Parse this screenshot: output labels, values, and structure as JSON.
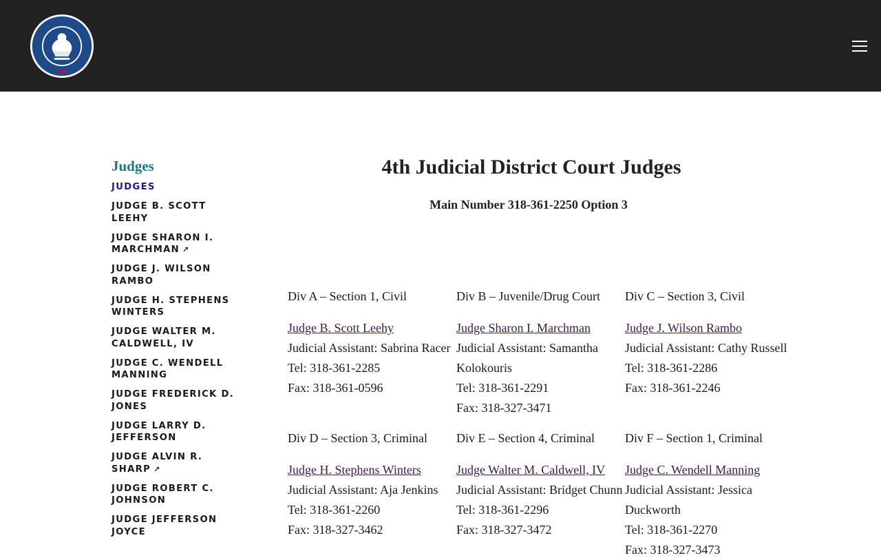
{
  "header": {
    "seal_text": "STATE OF LOUISIANA",
    "seal_motto": "UNION · JUSTICE · CONFIDENCE",
    "menu_icon": "hamburger-menu-icon"
  },
  "sidebar": {
    "heading": "Judges",
    "items": [
      {
        "label": "JUDGES",
        "active": true,
        "external": false
      },
      {
        "label": "JUDGE B. SCOTT LEEHY",
        "active": false,
        "external": false
      },
      {
        "label": "JUDGE SHARON I. MARCHMAN",
        "active": false,
        "external": true
      },
      {
        "label": "JUDGE J. WILSON RAMBO",
        "active": false,
        "external": false
      },
      {
        "label": "JUDGE H. STEPHENS WINTERS",
        "active": false,
        "external": false
      },
      {
        "label": "JUDGE WALTER M. CALDWELL, IV",
        "active": false,
        "external": false
      },
      {
        "label": "JUDGE C. WENDELL MANNING",
        "active": false,
        "external": false
      },
      {
        "label": "JUDGE FREDERICK D. JONES",
        "active": false,
        "external": false
      },
      {
        "label": "JUDGE LARRY D. JEFFERSON",
        "active": false,
        "external": false
      },
      {
        "label": "JUDGE ALVIN R. SHARP",
        "active": false,
        "external": true
      },
      {
        "label": "JUDGE ROBERT C. JOHNSON",
        "active": false,
        "external": false
      },
      {
        "label": "JUDGE JEFFERSON JOYCE",
        "active": false,
        "external": false
      }
    ],
    "external_glyph": "↗"
  },
  "main": {
    "title": "4th Judicial District Court Judges",
    "main_number": "Main Number 318-361-2250 Option 3",
    "divisions": [
      {
        "division": "Div A – Section 1, Civil",
        "judge": "Judge B. Scott Leehy",
        "assistant": "Judicial Assistant: Sabrina Racer",
        "tel": "Tel: 318-361-2285",
        "fax": "Fax: 318-361-0596"
      },
      {
        "division": "Div B – Juvenile/Drug Court",
        "judge": "Judge Sharon I. Marchman",
        "assistant": "Judicial Assistant: Samantha Kolokouris",
        "tel": "Tel: 318-361-2291",
        "fax": "Fax: 318-327-3471"
      },
      {
        "division": "Div C – Section 3, Civil",
        "judge": "Judge J. Wilson Rambo",
        "assistant": "Judicial Assistant: Cathy Russell",
        "tel": "Tel: 318-361-2286",
        "fax": "Fax: 318-361-2246"
      },
      {
        "division": "Div D – Section 3, Criminal",
        "judge": "Judge H. Stephens Winters",
        "assistant": "Judicial Assistant: Aja Jenkins",
        "tel": "Tel: 318-361-2260",
        "fax": "Fax: 318-327-3462"
      },
      {
        "division": "Div E – Section 4, Criminal",
        "judge": "Judge Walter M. Caldwell, IV",
        "assistant": "Judicial Assistant: Bridget Chunn",
        "tel": "Tel: 318-361-2296",
        "fax": "Fax: 318-327-3472"
      },
      {
        "division": "Div F – Section 1, Criminal",
        "judge": "Judge C. Wendell Manning",
        "assistant": "Judicial Assistant: Jessica Duckworth",
        "tel": "Tel: 318-361-2270",
        "fax": "Fax: 318-327-3473"
      }
    ]
  },
  "colors": {
    "header_bg": "#222222",
    "sidebar_heading": "#1a7a7a",
    "active_link": "#1a1a90",
    "judge_link": "#3d1a4d"
  }
}
